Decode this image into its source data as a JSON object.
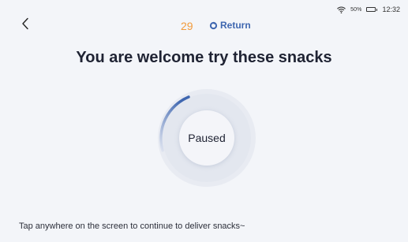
{
  "status_bar": {
    "battery_percent": "50%",
    "battery_level": 0.5,
    "time": "12:32",
    "icons": [
      "wifi-icon",
      "battery-icon"
    ]
  },
  "header": {
    "back_icon": "chevron-left-icon",
    "countdown": "29",
    "countdown_color": "#f29b3c",
    "return_icon": "return-icon",
    "return_label": "Return",
    "return_color": "#3f67b0"
  },
  "headline": "You are welcome try these snacks",
  "dial": {
    "label": "Paused",
    "progress_arc_color": "#3f67b0"
  },
  "hint": "Tap anywhere on the screen to continue to deliver snacks~"
}
